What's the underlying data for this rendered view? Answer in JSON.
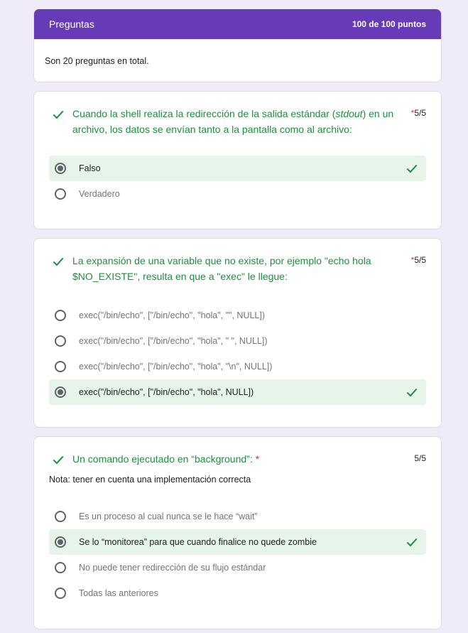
{
  "header": {
    "title": "Preguntas",
    "score": "100 de 100 puntos",
    "info": "Son 20 preguntas en total."
  },
  "questions": [
    {
      "text_pre": "Cuando la shell realiza la redirección de la salida estándar (",
      "text_em": "stdout",
      "text_post": ") en un archivo, los datos se envían tanto a la pantalla como al archivo:",
      "required": "*",
      "points": "5/5",
      "options": [
        {
          "label": "Falso",
          "selected": true
        },
        {
          "label": "Verdadero",
          "selected": false
        }
      ]
    },
    {
      "text": "La expansión de una variable que no existe, por ejemplo \"echo hola $NO_EXISTE\", resulta en que a \"exec\" le llegue:",
      "required": "*",
      "points": "5/5",
      "options": [
        {
          "label": "exec(\"/bin/echo\", [\"/bin/echo\", \"hola\", \"\", NULL])",
          "selected": false
        },
        {
          "label": "exec(\"/bin/echo\", [\"/bin/echo\", \"hola\", \" \", NULL])",
          "selected": false
        },
        {
          "label": "exec(\"/bin/echo\", [\"/bin/echo\", \"hola\", \"\\n\", NULL])",
          "selected": false
        },
        {
          "label": "exec(\"/bin/echo\", [\"/bin/echo\", \"hola\", NULL])",
          "selected": true
        }
      ]
    },
    {
      "text": "Un comando ejecutado en “background”:",
      "required": "*",
      "points": "5/5",
      "note": "Nota: tener en cuenta una implementación correcta",
      "options": [
        {
          "label": "Es un proceso al cual nunca se le hace “wait”",
          "selected": false
        },
        {
          "label": "Se lo “monitorea” para que cuando finalice no quede zombie",
          "selected": true
        },
        {
          "label": "No puede tener redirección de su flujo estándar",
          "selected": false
        },
        {
          "label": "Todas las anteriores",
          "selected": false
        }
      ]
    }
  ],
  "icons": {
    "correct": "check-icon",
    "radio_on": "radio-selected-icon",
    "radio_off": "radio-unselected-icon"
  },
  "colors": {
    "accent": "#673ab7",
    "correct": "#1e8e3e",
    "correct_bg": "#e6f4ea",
    "required": "#d93025",
    "background": "#f0ebf8"
  }
}
